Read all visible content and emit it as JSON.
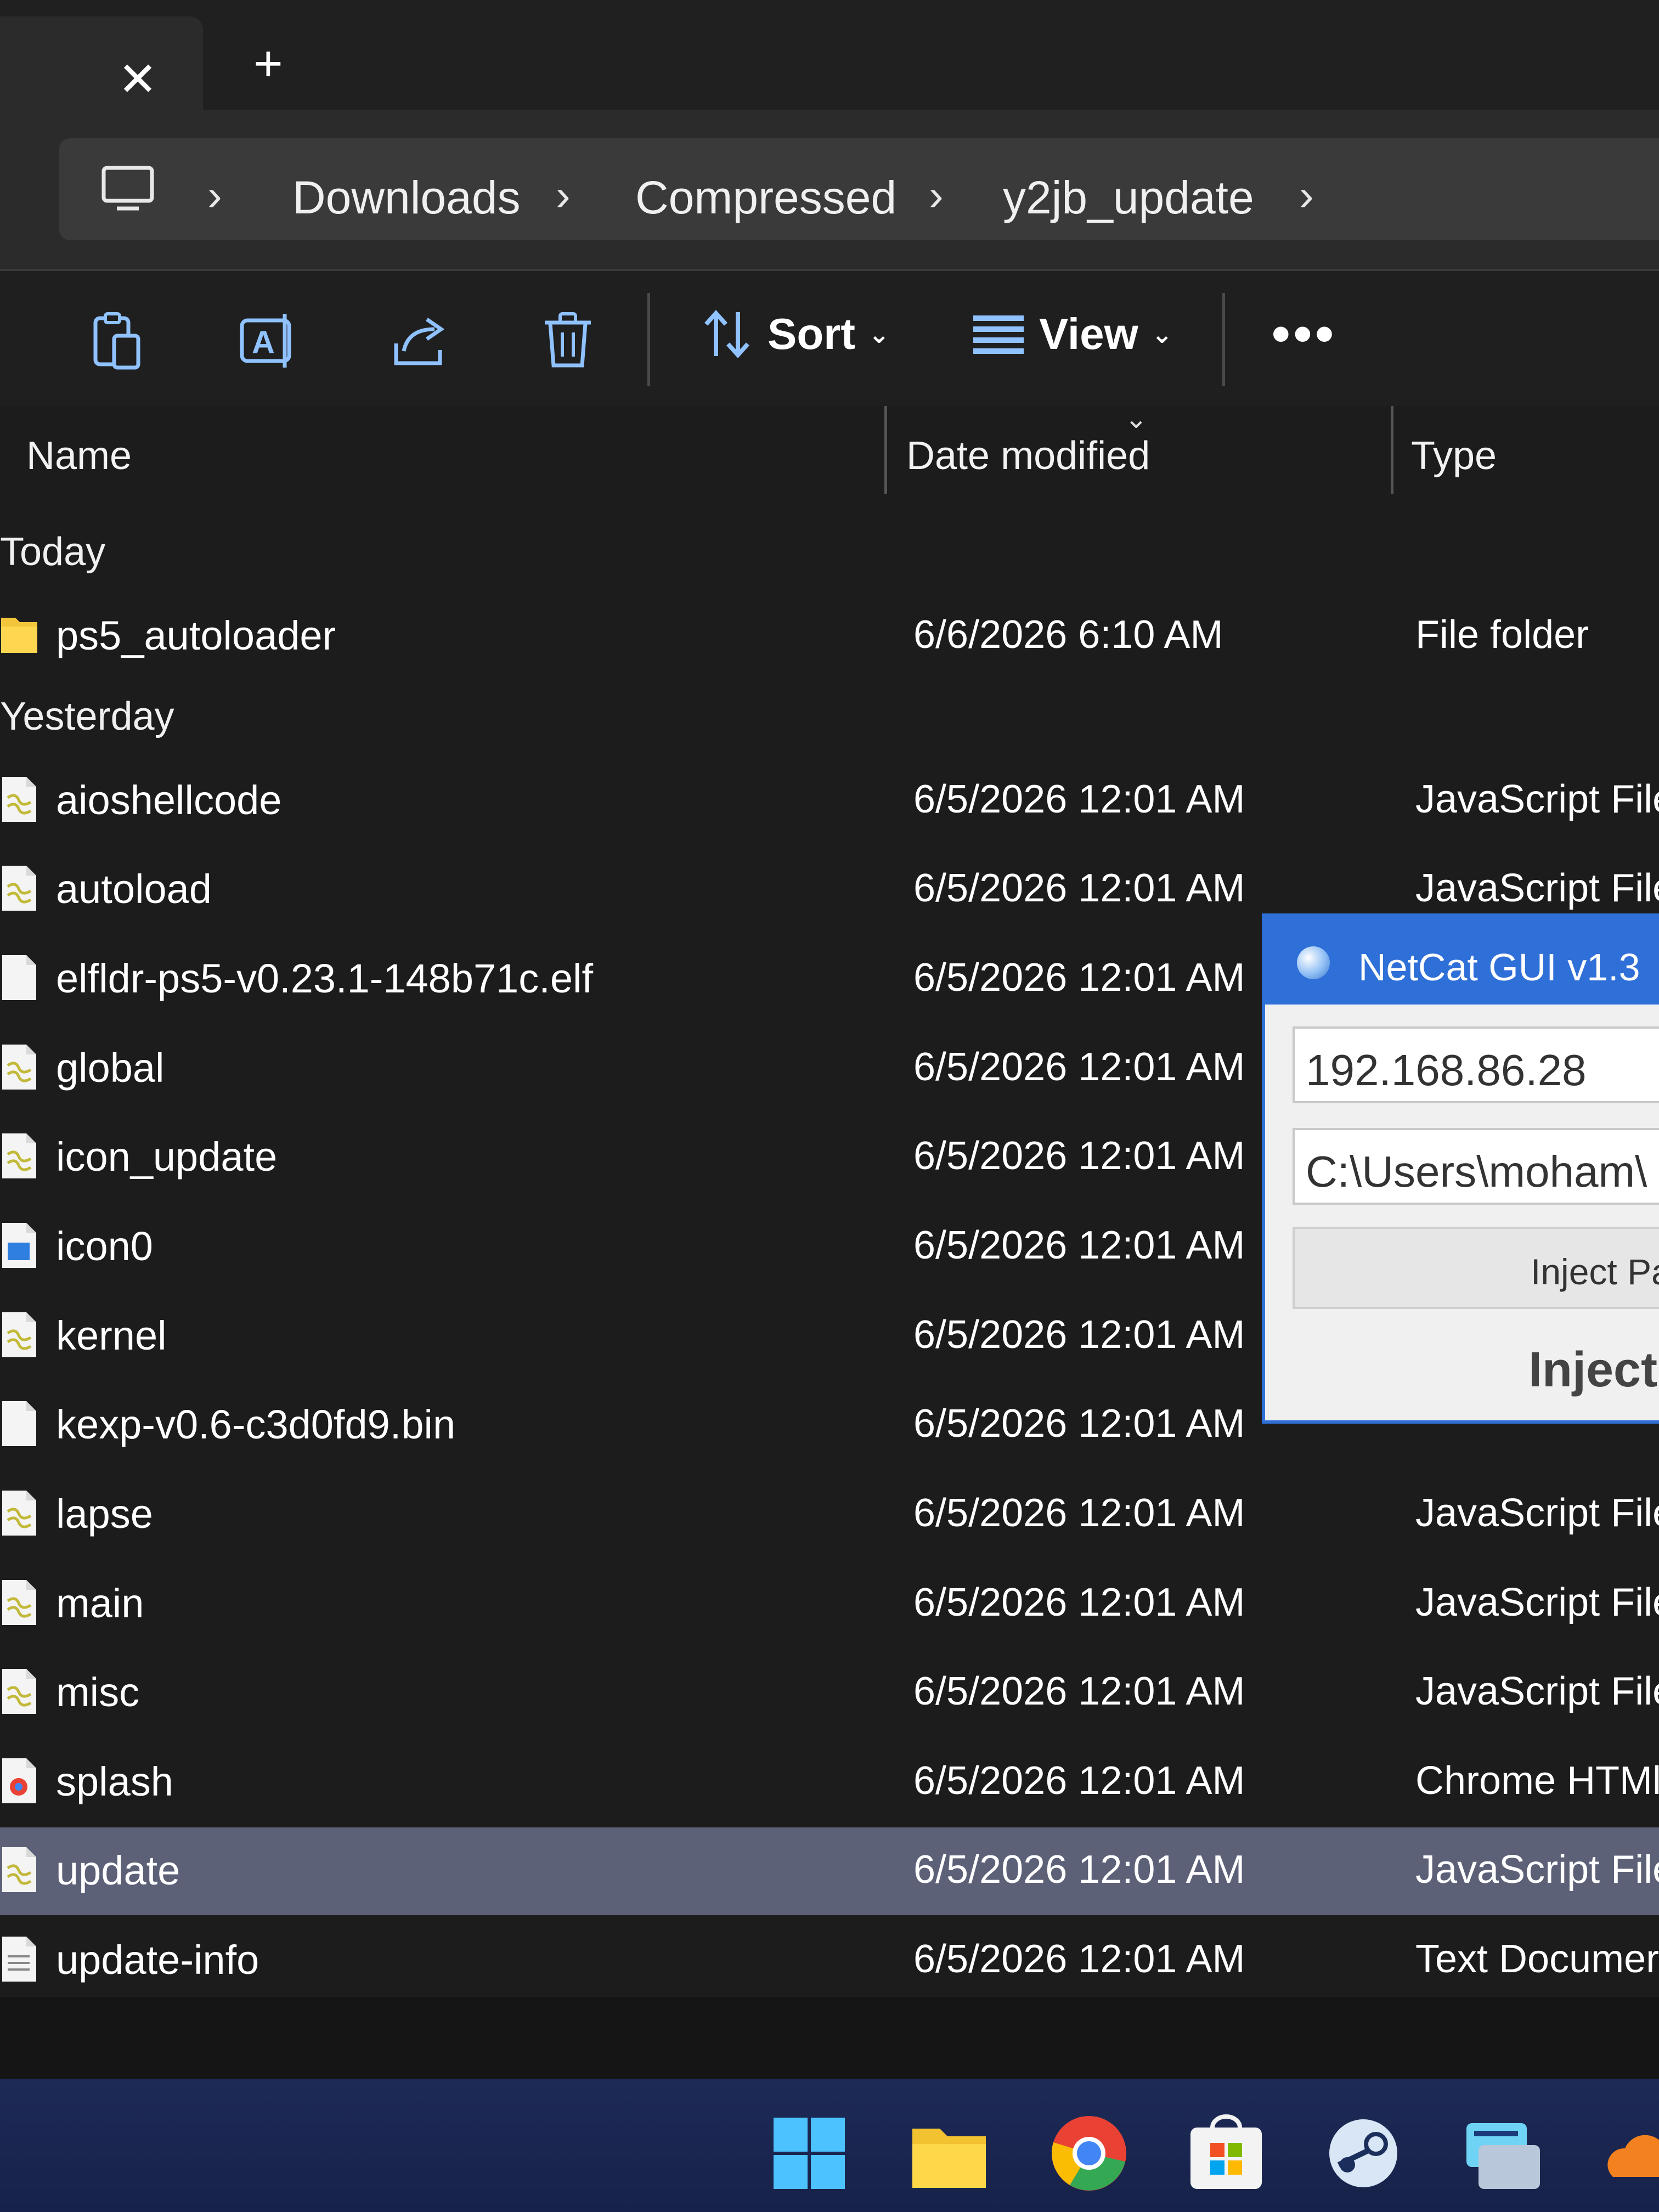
{
  "tabs": {
    "close_glyph": "✕",
    "new_glyph": "+"
  },
  "breadcrumb": [
    "Downloads",
    "Compressed",
    "y2jb_update"
  ],
  "toolbar": {
    "sort_label": "Sort",
    "view_label": "View",
    "more_label": "•••"
  },
  "columns": {
    "name": "Name",
    "date": "Date modified",
    "type": "Type"
  },
  "groups": {
    "today": "Today",
    "yesterday": "Yesterday"
  },
  "files": [
    {
      "name": "ps5_autoloader",
      "date": "6/6/2026 6:10 AM",
      "type": "File folder",
      "icon": "folder-icon"
    },
    {
      "name": "aioshellcode",
      "date": "6/5/2026 12:01 AM",
      "type": "JavaScript File",
      "icon": "js-file-icon"
    },
    {
      "name": "autoload",
      "date": "6/5/2026 12:01 AM",
      "type": "JavaScript File",
      "icon": "js-file-icon"
    },
    {
      "name": "elfldr-ps5-v0.23.1-148b71c.elf",
      "date": "6/5/2026 12:01 AM",
      "type": "",
      "icon": "file-icon"
    },
    {
      "name": "global",
      "date": "6/5/2026 12:01 AM",
      "type": "",
      "icon": "js-file-icon"
    },
    {
      "name": "icon_update",
      "date": "6/5/2026 12:01 AM",
      "type": "",
      "icon": "js-file-icon"
    },
    {
      "name": "icon0",
      "date": "6/5/2026 12:01 AM",
      "type": "",
      "icon": "image-file-icon"
    },
    {
      "name": "kernel",
      "date": "6/5/2026 12:01 AM",
      "type": "",
      "icon": "js-file-icon"
    },
    {
      "name": "kexp-v0.6-c3d0fd9.bin",
      "date": "6/5/2026 12:01 AM",
      "type": "",
      "icon": "file-icon"
    },
    {
      "name": "lapse",
      "date": "6/5/2026 12:01 AM",
      "type": "JavaScript File",
      "icon": "js-file-icon"
    },
    {
      "name": "main",
      "date": "6/5/2026 12:01 AM",
      "type": "JavaScript File",
      "icon": "js-file-icon"
    },
    {
      "name": "misc",
      "date": "6/5/2026 12:01 AM",
      "type": "JavaScript File",
      "icon": "js-file-icon"
    },
    {
      "name": "splash",
      "date": "6/5/2026 12:01 AM",
      "type": "Chrome HTMl",
      "icon": "chrome-html-icon"
    },
    {
      "name": "update",
      "date": "6/5/2026 12:01 AM",
      "type": "JavaScript File",
      "icon": "js-file-icon",
      "selected": true
    },
    {
      "name": "update-info",
      "date": "6/5/2026 12:01 AM",
      "type": "Text Documer",
      "icon": "text-file-icon"
    }
  ],
  "netcat": {
    "title": "NetCat GUI v1.3",
    "ip_value": "192.168.86.28",
    "path_value": "C:\\Users\\moham\\",
    "inject_payload_button": "Inject Pa",
    "inject_label": "Inject"
  },
  "taskbar": [
    "start-icon",
    "file-explorer-icon",
    "chrome-icon",
    "microsoft-store-icon",
    "steam-icon",
    "keyboard-app-icon",
    "cloud-icon"
  ],
  "colors": {
    "selected_row": "#5c6178",
    "netcat_titlebar": "#2f6fd8",
    "taskbar": "#1d2a56"
  }
}
